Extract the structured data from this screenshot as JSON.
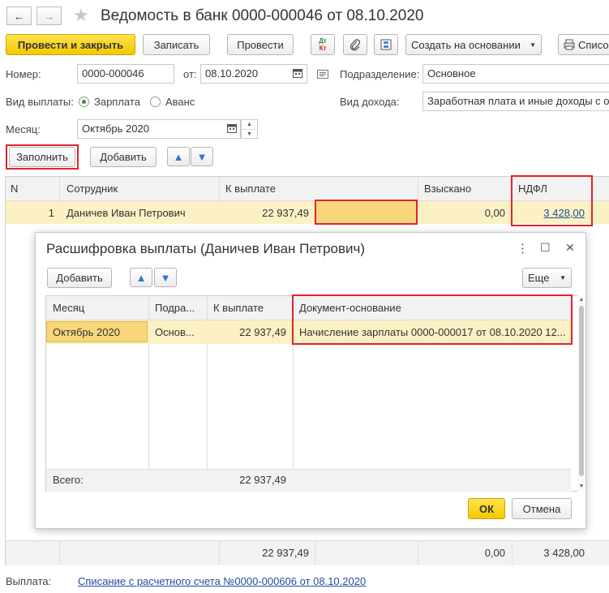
{
  "window": {
    "title": "Ведомость в банк 0000-000046 от 08.10.2020",
    "back_glyph": "←",
    "forward_glyph": "→",
    "star_glyph": "★"
  },
  "toolbar": {
    "post_close": "Провести и закрыть",
    "save": "Записать",
    "post": "Провести",
    "dtkt_top": "Дт",
    "dtkt_bottom": "Кт",
    "create_based": "Создать на основании",
    "list": "Списо"
  },
  "form": {
    "number_label": "Номер:",
    "number_value": "0000-000046",
    "from_label": "от:",
    "date_value": "08.10.2020",
    "division_label": "Подразделение:",
    "division_value": "Основное",
    "pay_type_label": "Вид выплаты:",
    "pay_salary": "Зарплата",
    "pay_advance": "Аванс",
    "income_type_label": "Вид дохода:",
    "income_type_value": "Заработная плата и иные доходы с о",
    "month_label": "Месяц:",
    "month_value": "Октябрь 2020"
  },
  "table_toolbar": {
    "fill": "Заполнить",
    "add": "Добавить"
  },
  "table": {
    "columns": [
      "N",
      "Сотрудник",
      "К выплате",
      "Взыскано",
      "НДФЛ"
    ],
    "rows": [
      {
        "n": "1",
        "employee": "Даничев Иван Петрович",
        "to_pay": "22 937,49",
        "collected": "0,00",
        "ndfl": "3 428,00"
      }
    ],
    "totals": {
      "to_pay": "22 937,49",
      "collected": "0,00",
      "ndfl": "3 428,00"
    }
  },
  "dialog": {
    "title": "Расшифровка выплаты (Даничев Иван Петрович)",
    "more_glyph": "⋮",
    "max_glyph": "☐",
    "close_glyph": "✕",
    "add": "Добавить",
    "more": "Еще",
    "columns": [
      "Месяц",
      "Подра...",
      "К выплате",
      "Документ-основание"
    ],
    "rows": [
      {
        "month": "Октябрь 2020",
        "division": "Основ...",
        "to_pay": "22 937,49",
        "document": "Начисление зарплаты 0000-000017 от 08.10.2020 12..."
      }
    ],
    "total_label": "Всего:",
    "total_value": "22 937,49",
    "ok": "ОК",
    "cancel": "Отмена"
  },
  "footer": {
    "payment_label": "Выплата:",
    "payment_link": "Списание с расчетного счета №0000-000606 от 08.10.2020"
  }
}
